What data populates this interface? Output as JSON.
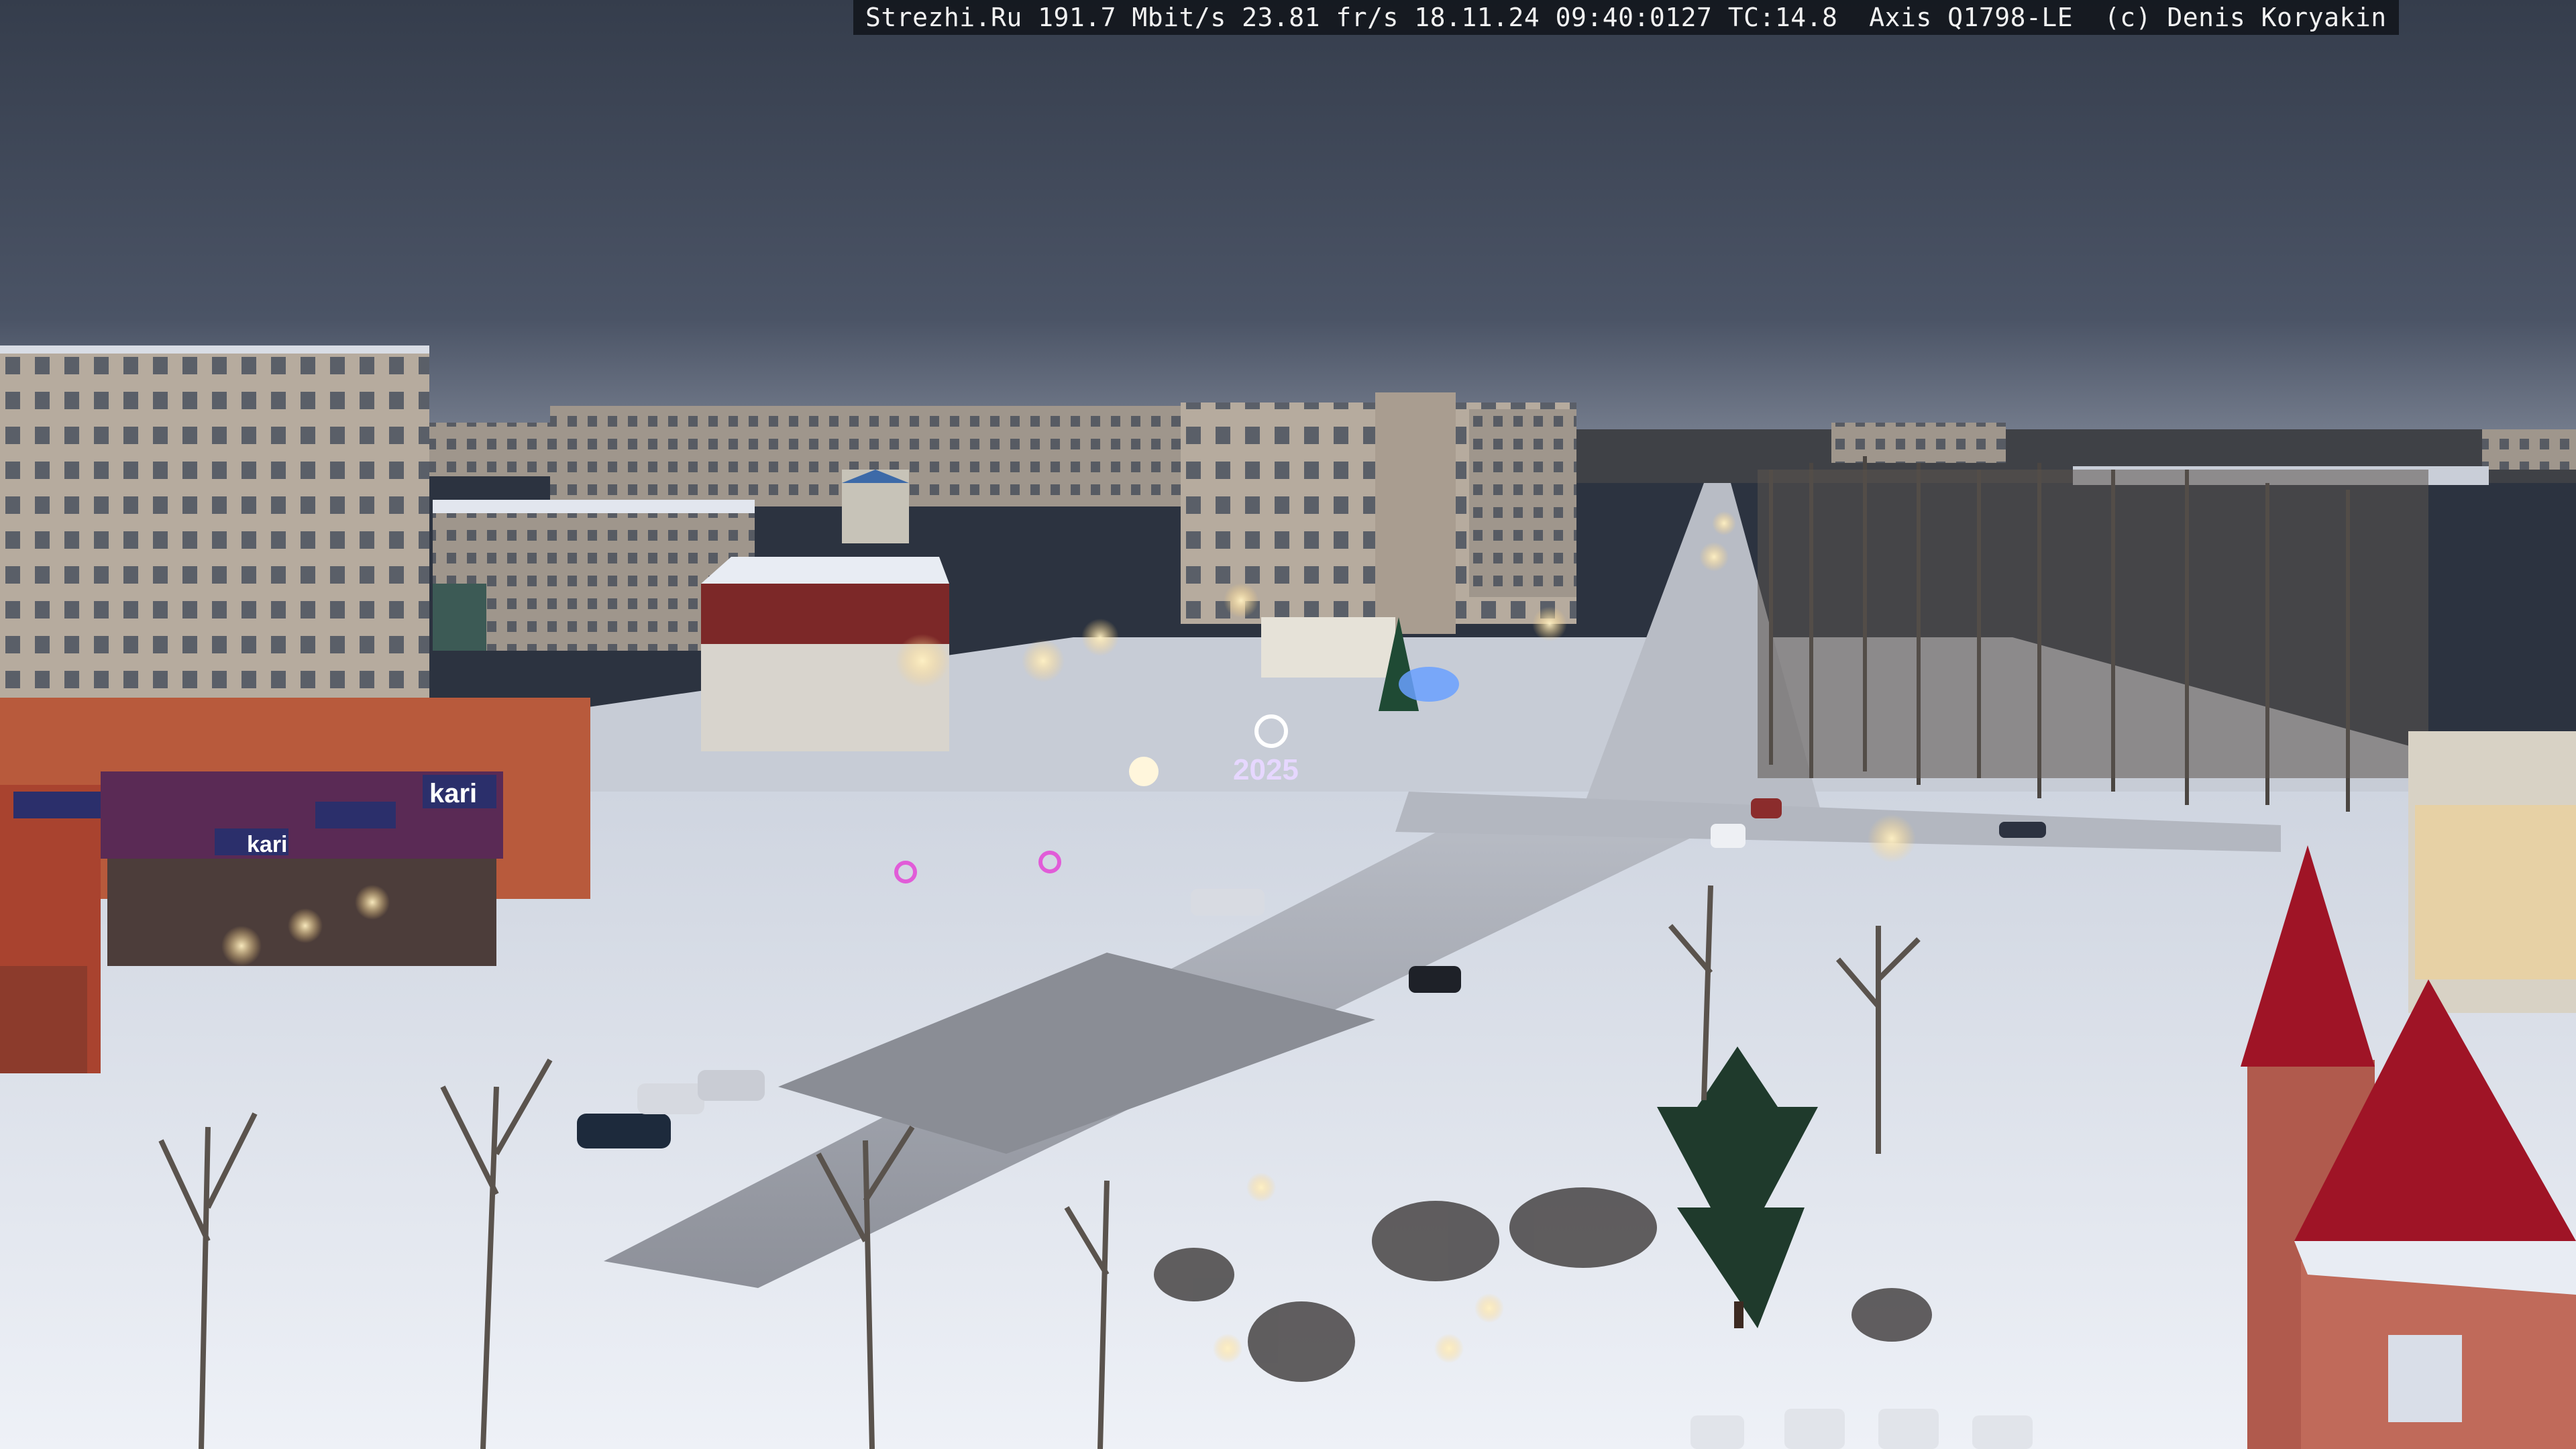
{
  "overlay": {
    "text": "Strezhi.Ru 191.7 Mbit/s 23.81 fr/s 18.11.24 09:40:0127 TC:14.8  Axis Q1798-LE  (c) Denis Koryakin"
  },
  "signs": {
    "store_brand_main": "kari",
    "store_brand_left": "kari",
    "new_year_number": "2025"
  },
  "colors": {
    "sky_top": "#3a4354",
    "sky_horizon": "#7f8795",
    "snow": "#e9edf5",
    "road": "#a7abb4",
    "panel_buildings": "#b8ada0",
    "store_facade": "#b85a3c",
    "store_sign_band": "#5a2a55",
    "roof_red": "#a5182a",
    "lights_warm": "#ffd27a",
    "lights_cool": "#dfe8ff",
    "decor_pink": "#e15cd8",
    "decor_blue": "#6aa0ff"
  }
}
